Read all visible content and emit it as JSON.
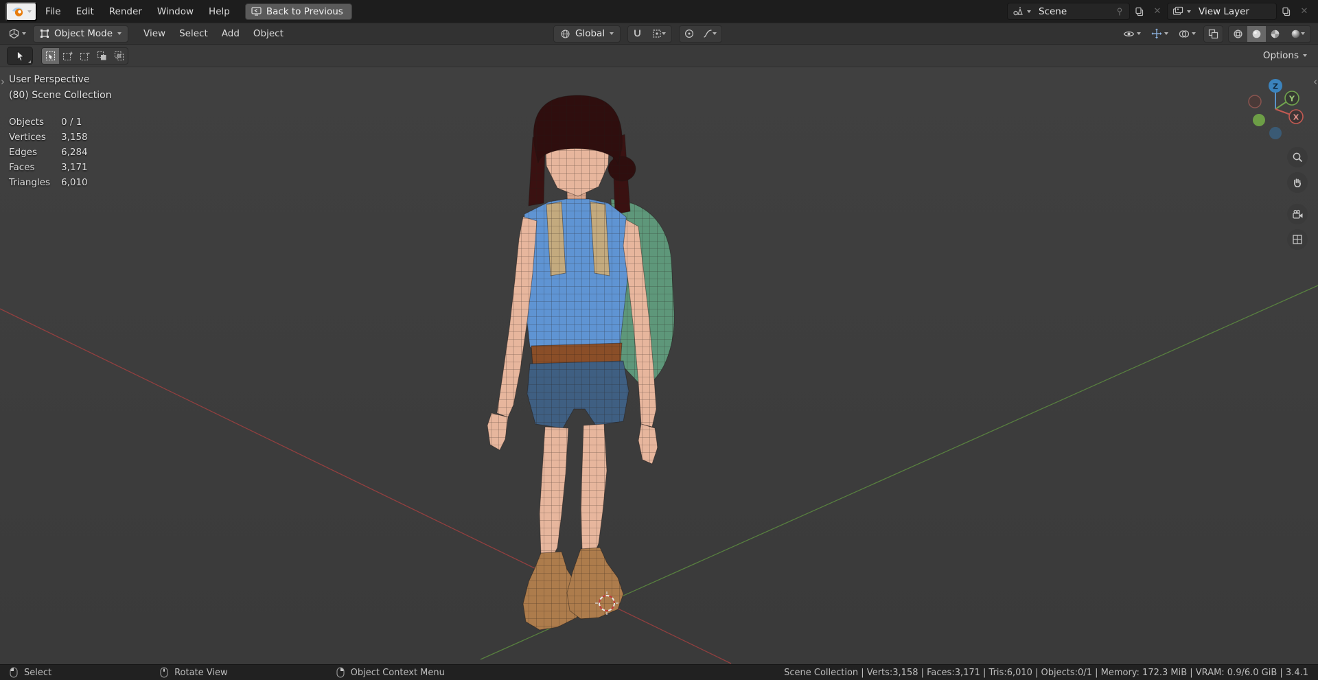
{
  "app": {
    "title": "Blender"
  },
  "glyphs": {
    "close": "✕",
    "chevron_left": "‹",
    "chevron_right": "›"
  },
  "topbar": {
    "menus": [
      {
        "label": "File"
      },
      {
        "label": "Edit"
      },
      {
        "label": "Render"
      },
      {
        "label": "Window"
      },
      {
        "label": "Help"
      }
    ],
    "back_button": {
      "label": "Back to Previous"
    },
    "scene": {
      "value": "Scene"
    },
    "view_layer": {
      "value": "View Layer"
    }
  },
  "header": {
    "mode": {
      "label": "Object Mode"
    },
    "menus": [
      {
        "label": "View"
      },
      {
        "label": "Select"
      },
      {
        "label": "Add"
      },
      {
        "label": "Object"
      }
    ],
    "orientation": {
      "label": "Global"
    },
    "options": {
      "label": "Options"
    }
  },
  "viewport": {
    "perspective": "User Perspective",
    "collection": "(80) Scene Collection",
    "stats": {
      "rows": [
        {
          "label": "Objects",
          "value": "0 / 1"
        },
        {
          "label": "Vertices",
          "value": "3,158"
        },
        {
          "label": "Edges",
          "value": "6,284"
        },
        {
          "label": "Faces",
          "value": "3,171"
        },
        {
          "label": "Triangles",
          "value": "6,010"
        }
      ]
    },
    "gizmo": {
      "axes": [
        "Z",
        "Y",
        "X"
      ]
    }
  },
  "statusbar": {
    "hints": [
      {
        "label": "Select"
      },
      {
        "label": "Rotate View"
      },
      {
        "label": "Object Context Menu"
      }
    ],
    "info": "Scene Collection | Verts:3,158 | Faces:3,171 | Tris:6,010 | Objects:0/1 | Memory: 172.3 MiB | VRAM: 0.9/6.0 GiB | 3.4.1"
  },
  "colors": {
    "accent": "#4772b3",
    "axis_x": "#b4433f",
    "axis_y": "#6d9e46",
    "axis_z": "#3b83bd",
    "logo_orange": "#e87d0d"
  }
}
